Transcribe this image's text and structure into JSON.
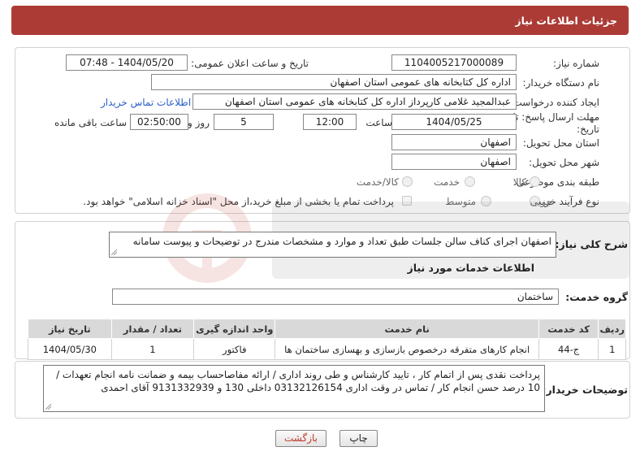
{
  "header": {
    "title": "جزئیات اطلاعات نیاز"
  },
  "form": {
    "need_number_label": "شماره نیاز:",
    "need_number": "1104005217000089",
    "announce_label": "تاریخ و ساعت اعلان عمومی:",
    "announce_value": "1404/05/20 - 07:48",
    "buyer_org_label": "نام دستگاه خریدار:",
    "buyer_org": "اداره کل کتابخانه های عمومی استان اصفهان",
    "creator_label": "ایجاد کننده درخواست:",
    "creator": "عبدالمجید غلامی کارپرداز اداره کل کتابخانه های عمومی استان اصفهان",
    "contact_link": "اطلاعات تماس خریدار",
    "deadline_label_line1": "مهلت ارسال پاسخ: تا",
    "deadline_label_line2": "تاریخ:",
    "deadline_date": "1404/05/25",
    "time_label": "ساعت",
    "deadline_time": "12:00",
    "days_value": "5",
    "days_label": "روز و",
    "remaining_time": "02:50:00",
    "remaining_label": "ساعت باقی مانده",
    "province_label": "استان محل تحویل:",
    "province": "اصفهان",
    "city_label": "شهر محل تحویل:",
    "city": "اصفهان",
    "category_label": "طبقه بندی موضوعی:",
    "category_options": [
      "کالا",
      "خدمت",
      "کالا/خدمت"
    ],
    "process_label": "نوع فرآیند خرید :",
    "process_options": [
      "جزیی",
      "متوسط"
    ],
    "payment_note": "پرداخت تمام یا بخشی از مبلغ خرید،از محل \"اسناد خزانه اسلامی\" خواهد بود."
  },
  "description": {
    "label": "شرح کلی نیاز:",
    "text": "اصفهان اجرای کناف سالن جلسات طبق تعداد و موارد و مشخصات مندرج در توضیحات و پیوست سامانه"
  },
  "services": {
    "section_title": "اطلاعات خدمات مورد نیاز",
    "group_label": "گروه خدمت:",
    "group_value": "ساختمان",
    "columns": [
      "ردیف",
      "کد خدمت",
      "نام خدمت",
      "واحد اندازه گیری",
      "تعداد / مقدار",
      "تاریخ نیاز"
    ],
    "rows": [
      [
        "1",
        "ج-44",
        "انجام کارهای متفرقه درخصوص بازسازی و بهسازی ساختمان ها",
        "فاکتور",
        "1",
        "1404/05/30"
      ]
    ]
  },
  "buyer_notes": {
    "label": "توضیحات خریدار:",
    "text": "پرداخت نقدی پس از اتمام کار ، تایید کارشناس و طی روند اداری / ارائه مفاصاحساب بیمه و ضمانت نامه انجام تعهدات / 10 درصد حسن انجام کار / تماس در وقت اداری 03132126154 داخلی 130 و 9131332939 آقای احمدی"
  },
  "buttons": {
    "print": "چاپ",
    "back": "بازگشت"
  },
  "colors": {
    "header_bg": "#ac3b36",
    "link": "#2a61c8",
    "back_text": "#c0392b"
  }
}
